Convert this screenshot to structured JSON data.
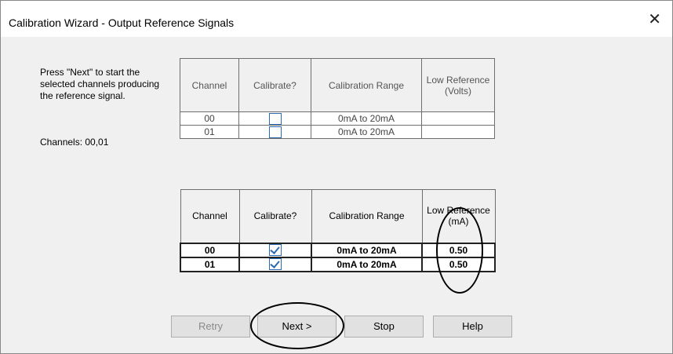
{
  "window": {
    "title": "Calibration Wizard - Output Reference Signals",
    "close_glyph": "✕"
  },
  "instructions": {
    "text": "Press \"Next\" to start the selected channels producing the reference signal.",
    "channels": "Channels: 00,01"
  },
  "table1": {
    "headers": [
      "Channel",
      "Calibrate?",
      "Calibration Range",
      "Low Reference (Volts)"
    ],
    "rows": [
      {
        "channel": "00",
        "calibrate": false,
        "range": "0mA to 20mA",
        "low_ref": ""
      },
      {
        "channel": "01",
        "calibrate": false,
        "range": "0mA to 20mA",
        "low_ref": ""
      }
    ]
  },
  "table2": {
    "headers": [
      "Channel",
      "Calibrate?",
      "Calibration Range",
      "Low Reference (mA)"
    ],
    "rows": [
      {
        "channel": "00",
        "calibrate": true,
        "range": "0mA to 20mA",
        "low_ref": "0.50"
      },
      {
        "channel": "01",
        "calibrate": true,
        "range": "0mA to 20mA",
        "low_ref": "0.50"
      }
    ]
  },
  "buttons": {
    "retry": "Retry",
    "next": "Next >",
    "stop": "Stop",
    "help": "Help"
  }
}
